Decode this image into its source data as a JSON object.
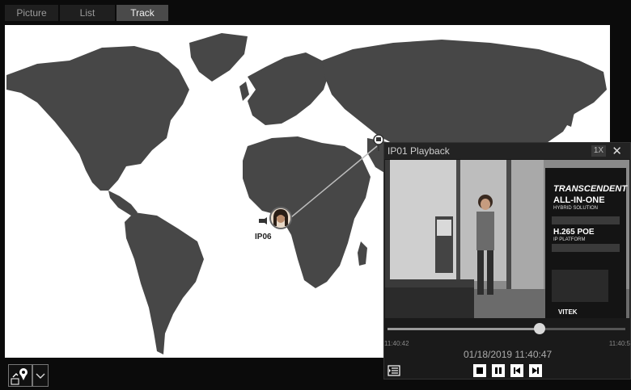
{
  "tabs": [
    {
      "label": "Picture"
    },
    {
      "label": "List"
    },
    {
      "label": "Track",
      "active": true
    }
  ],
  "map": {
    "markers": [
      {
        "label": "IP06"
      }
    ]
  },
  "bottom_bar": {
    "icons": [
      "track-location-icon",
      "dropdown-chevron-icon"
    ]
  },
  "playback": {
    "title": "IP01 Playback",
    "speed": "1X",
    "close": "✕",
    "time_start": "11:40:42",
    "time_end": "11:40:5",
    "datetime": "01/18/2019 11:40:47",
    "progress": 0.64,
    "video_sign": {
      "brand": "TRANSCENDENT",
      "line1": "ALL-IN-ONE",
      "line2": "HYBRID SOLUTION",
      "line3": "H.265 POE",
      "line4": "IP PLATFORM",
      "logo": "VITEK"
    },
    "controls": [
      "list-icon",
      "stop-icon",
      "pause-icon",
      "prev-frame-icon",
      "next-frame-icon"
    ]
  }
}
